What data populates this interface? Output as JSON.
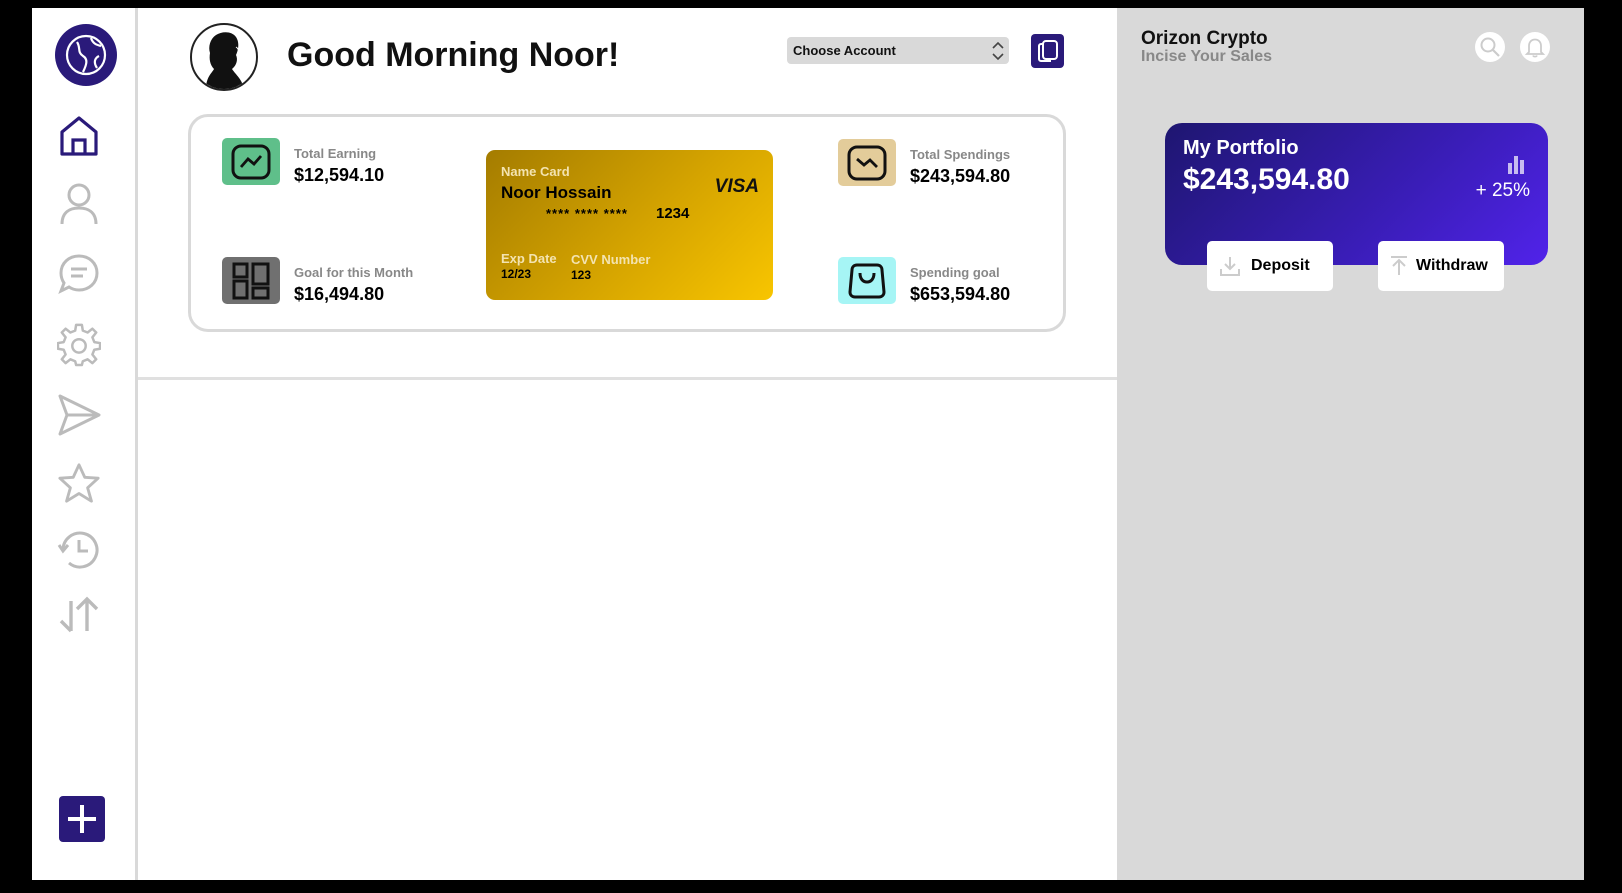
{
  "header": {
    "greeting": "Good Morning Noor!",
    "account_select": "Choose Account"
  },
  "stats": {
    "total_earning": {
      "label": "Total Earning",
      "value": "$12,594.10"
    },
    "goal_month": {
      "label": "Goal for this Month",
      "value": "$16,494.80"
    },
    "total_spendings": {
      "label": "Total Spendings",
      "value": "$243,594.80"
    },
    "spending_goal": {
      "label": "Spending goal",
      "value": "$653,594.80"
    }
  },
  "card": {
    "name_label": "Name Card",
    "name": "Noor Hossain",
    "brand": "VISA",
    "number_masked": "**** **** ****",
    "number_last": "1234",
    "exp_label": "Exp Date",
    "exp_value": "12/23",
    "cvv_label": "CVV Number",
    "cvv_value": "123"
  },
  "right": {
    "brand": "Orizon Crypto",
    "tagline": "Incise Your Sales"
  },
  "portfolio": {
    "title": "My Portfolio",
    "value": "$243,594.80",
    "change": "+ 25%",
    "deposit_label": "Deposit",
    "withdraw_label": "Withdraw"
  },
  "colors": {
    "accent": "#2a1a7a",
    "earning_icon_bg": "#5fbf8a",
    "goal_icon_bg": "#707070",
    "spendings_icon_bg": "#e3cc9a",
    "spending_goal_icon_bg": "#a6f5f5"
  },
  "icons": [
    "globe-logo-icon",
    "home-icon",
    "user-icon",
    "chat-icon",
    "settings-icon",
    "send-icon",
    "star-icon",
    "history-icon",
    "transfer-icon",
    "plus-icon",
    "copy-icon",
    "trend-up-icon",
    "dashboard-icon",
    "trend-down-icon",
    "shopping-bag-icon",
    "search-icon",
    "bell-icon",
    "bar-chart-icon",
    "download-icon",
    "upload-icon"
  ]
}
